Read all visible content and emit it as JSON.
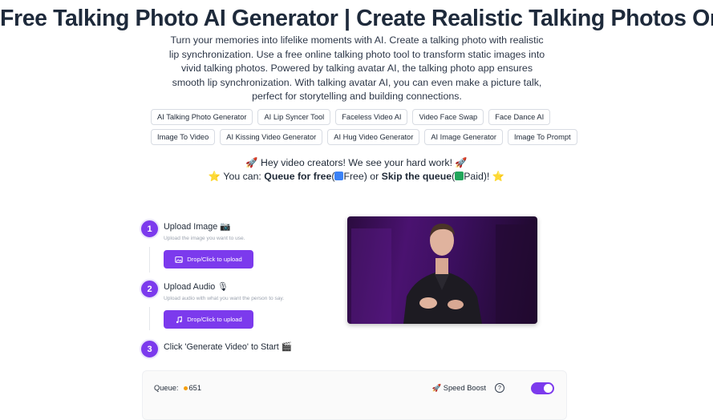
{
  "title": "Free Talking Photo AI Generator | Create Realistic Talking Photos Online",
  "description": "Turn your memories into lifelike moments with AI. Create a talking photo with realistic lip synchronization. Use a free online talking photo tool to transform static images into vivid talking photos. Powered by talking avatar AI, the talking photo app ensures smooth lip synchronization. With talking avatar AI, you can even make a picture talk, perfect for storytelling and building connections.",
  "tags": {
    "row1": [
      "AI Talking Photo Generator",
      "AI Lip Syncer Tool",
      "Faceless Video AI",
      "Video Face Swap",
      "Face Dance AI"
    ],
    "row2": [
      "Image To Video",
      "AI Kissing Video Generator",
      "AI Hug Video Generator",
      "AI Image Generator",
      "Image To Prompt"
    ]
  },
  "promo": {
    "line1": "🚀 Hey video creators! We see your hard work! 🚀",
    "line2_prefix": "⭐ You can: ",
    "queue_free": "Queue for free",
    "open1": "(",
    "free_label": "Free",
    "close1": ")",
    "or": " or ",
    "skip_queue": "Skip the queue",
    "open2": "(",
    "paid_label": "Paid",
    "close2": ")! ⭐"
  },
  "steps": [
    {
      "num": "1",
      "title": "Upload Image 📷",
      "subtitle": "Upload the image you want to use.",
      "button": "Drop/Click to upload"
    },
    {
      "num": "2",
      "title": "Upload Audio 🎙",
      "subtitle": "Upload audio with what you want the person to say.",
      "button": "Drop/Click to upload"
    },
    {
      "num": "3",
      "title": "Click 'Generate Video' to Start 🎬"
    }
  ],
  "panel": {
    "queue_label": "Queue:",
    "queue_count": "651",
    "speed_boost": "🚀 Speed Boost",
    "help": "?"
  },
  "colors": {
    "accent": "#7c3aed",
    "free_badge": "#3b82f6",
    "paid_badge": "#22a55b"
  }
}
